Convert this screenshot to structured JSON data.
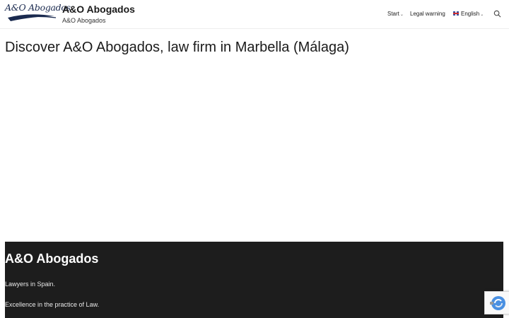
{
  "header": {
    "logo_text": "A&O Abogados",
    "site_title": "A&O Abogados",
    "tagline": "A&O Abogados"
  },
  "nav": {
    "start": "Start",
    "legal": "Legal warning",
    "language": "English",
    "search_icon": "search-icon"
  },
  "main": {
    "heading": "Discover A&O Abogados, law firm in Marbella (Málaga)"
  },
  "footer": {
    "title": "A&O Abogados",
    "line1": "Lawyers in Spain.",
    "line2": "Excellence in the practice of Law."
  },
  "colors": {
    "footer_bg": "#1d1d1d",
    "logo_navy": "#1a2a4f",
    "recaptcha_blue": "#4a90e2"
  }
}
